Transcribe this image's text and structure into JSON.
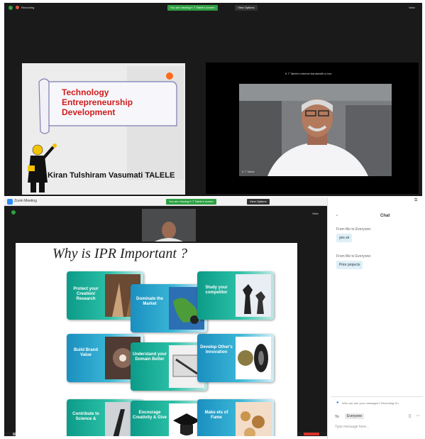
{
  "top_window": {
    "status_left": "Recording",
    "view_banner": "You are viewing K T Talele's screen",
    "view_options": "View Options",
    "view_button": "View",
    "speaker_name_caption": "K T Talele",
    "speaker_overlay": "K T Talele's internet bandwidth is low"
  },
  "slide1": {
    "title_lines": [
      "Technology",
      "Entrepreneurship",
      "Development"
    ],
    "author": "Kiran Tulshiram Vasumati TALELE"
  },
  "second_window": {
    "app_title": "Zoom Meeting",
    "view_banner": "You are viewing K T Talele's screen",
    "view_options": "View Options",
    "view_button": "View",
    "status_left": "Recording"
  },
  "slide2": {
    "title": "Why is IPR Important ?",
    "cards": [
      {
        "label": "Protect your Creation/ Research"
      },
      {
        "label": "Dominate the Market"
      },
      {
        "label": "Study your competitor"
      },
      {
        "label": "Build Brand Value"
      },
      {
        "label": "Understand your Domain Better"
      },
      {
        "label": "Develop Other's Innovation"
      },
      {
        "label": "Contribute to Science &"
      },
      {
        "label": "Encourage Creativity & Give"
      },
      {
        "label": "Make ets of Fame"
      }
    ]
  },
  "chat": {
    "header": "Chat",
    "messages": [
      {
        "from": "From Me to Everyone:",
        "text": "yes sir"
      },
      {
        "from": "From Me to Everyone:",
        "text": "Prior projects"
      }
    ],
    "notice": "Who can see your messages? Recording On",
    "to_label": "To:",
    "to_value": "Everyone",
    "input_placeholder": "Type message here..."
  },
  "colors": {
    "slide_red": "#d01c1c",
    "zoom_green": "#2ea043",
    "zoom_blue": "#2d8cff",
    "card_green": "#0c9b88",
    "card_blue": "#1b8fc0"
  }
}
